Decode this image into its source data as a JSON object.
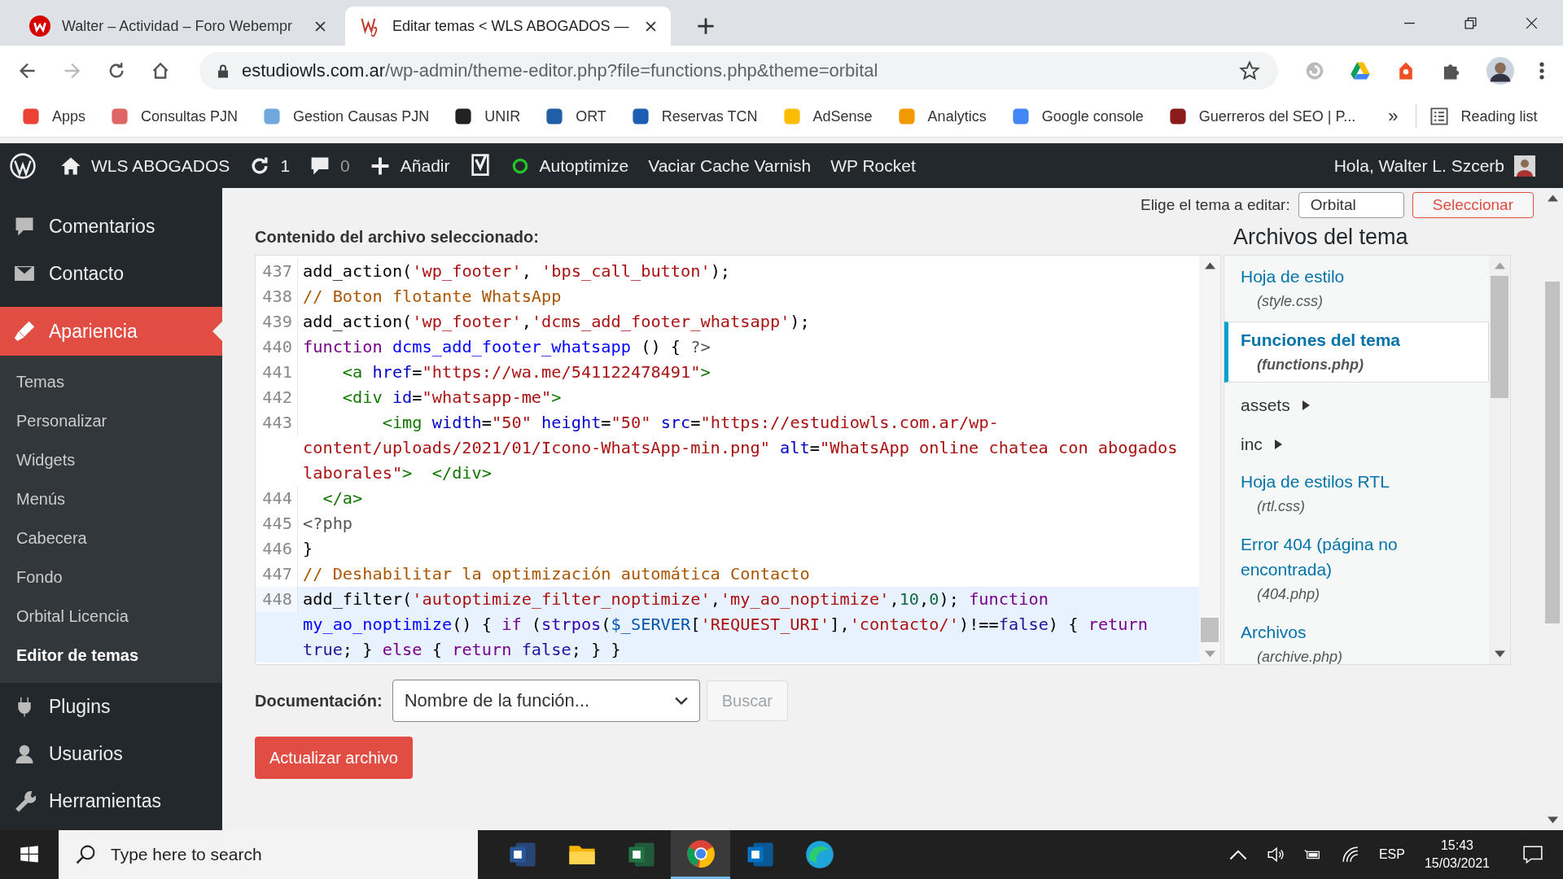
{
  "browser": {
    "tabs": [
      {
        "title": "Walter – Actividad – Foro Webempr",
        "selected": false
      },
      {
        "title": "Editar temas < WLS ABOGADOS —",
        "selected": true
      }
    ],
    "url": {
      "host": "estudiowls.com.ar",
      "path": "/wp-admin/theme-editor.php?file=functions.php&theme=orbital"
    },
    "bookmarks": [
      "Apps",
      "Consultas PJN",
      "Gestion Causas PJN",
      "UNIR",
      "ORT",
      "Reservas TCN",
      "AdSense",
      "Analytics",
      "Google console",
      "Guerreros del SEO | P..."
    ],
    "bookmarks_more": "»",
    "reading_list": "Reading list"
  },
  "admin_bar": {
    "site": "WLS ABOGADOS",
    "updates": "1",
    "comments": "0",
    "new": "Añadir",
    "items": [
      "Autoptimize",
      "Vaciar Cache Varnish",
      "WP Rocket"
    ],
    "greeting": "Hola, Walter L. Szcerb"
  },
  "sidebar": {
    "items": [
      {
        "label": "Comentarios",
        "selected": false
      },
      {
        "label": "Contacto",
        "selected": false
      },
      {
        "label": "Apariencia",
        "selected": true,
        "children": [
          {
            "label": "Temas",
            "selected": false
          },
          {
            "label": "Personalizar",
            "selected": false
          },
          {
            "label": "Widgets",
            "selected": false
          },
          {
            "label": "Menús",
            "selected": false
          },
          {
            "label": "Cabecera",
            "selected": false
          },
          {
            "label": "Fondo",
            "selected": false
          },
          {
            "label": "Orbital Licencia",
            "selected": false
          },
          {
            "label": "Editor de temas",
            "selected": true
          }
        ]
      },
      {
        "label": "Plugins",
        "selected": false
      },
      {
        "label": "Usuarios",
        "selected": false
      },
      {
        "label": "Herramientas",
        "selected": false
      }
    ]
  },
  "theme_picker": {
    "label": "Elige el tema a editar:",
    "value": "Orbital",
    "button": "Seleccionar"
  },
  "editor": {
    "label": "Contenido del archivo seleccionado:",
    "lines": [
      {
        "number": "437",
        "active": false,
        "rows": [
          {
            "segments": [
              {
                "kind": "plain",
                "text": "add_action("
              },
              {
                "kind": "string",
                "text": "'wp_footer'"
              },
              {
                "kind": "plain",
                "text": ", "
              },
              {
                "kind": "string",
                "text": "'bps_call_button'"
              },
              {
                "kind": "plain",
                "text": ");"
              }
            ]
          }
        ]
      },
      {
        "number": "438",
        "active": false,
        "rows": [
          {
            "segments": [
              {
                "kind": "comment",
                "text": "// Boton flotante WhatsApp"
              }
            ]
          }
        ]
      },
      {
        "number": "439",
        "active": false,
        "rows": [
          {
            "segments": [
              {
                "kind": "plain",
                "text": "add_action("
              },
              {
                "kind": "string",
                "text": "'wp_footer'"
              },
              {
                "kind": "plain",
                "text": ","
              },
              {
                "kind": "string",
                "text": "'dcms_add_footer_whatsapp'"
              },
              {
                "kind": "plain",
                "text": ");"
              }
            ]
          }
        ]
      },
      {
        "number": "440",
        "active": false,
        "rows": [
          {
            "segments": [
              {
                "kind": "keyword",
                "text": "function "
              },
              {
                "kind": "def",
                "text": "dcms_add_footer_whatsapp"
              },
              {
                "kind": "plain",
                "text": " () { "
              },
              {
                "kind": "meta",
                "text": "?>"
              }
            ]
          }
        ]
      },
      {
        "number": "441",
        "active": false,
        "rows": [
          {
            "segments": [
              {
                "kind": "tag",
                "text": "    <a "
              },
              {
                "kind": "attr",
                "text": "href"
              },
              {
                "kind": "plain",
                "text": "="
              },
              {
                "kind": "string",
                "text": "\"https://wa.me/541122478491\""
              },
              {
                "kind": "tag",
                "text": ">"
              }
            ]
          }
        ]
      },
      {
        "number": "442",
        "active": false,
        "rows": [
          {
            "segments": [
              {
                "kind": "tag",
                "text": "    <div "
              },
              {
                "kind": "attr",
                "text": "id"
              },
              {
                "kind": "plain",
                "text": "="
              },
              {
                "kind": "string",
                "text": "\"whatsapp-me\""
              },
              {
                "kind": "tag",
                "text": ">"
              }
            ]
          }
        ]
      },
      {
        "number": "443",
        "active": false,
        "rows": [
          {
            "segments": [
              {
                "kind": "tag",
                "text": "        <img "
              },
              {
                "kind": "attr",
                "text": "width"
              },
              {
                "kind": "plain",
                "text": "="
              },
              {
                "kind": "string",
                "text": "\"50\" "
              },
              {
                "kind": "attr",
                "text": "height"
              },
              {
                "kind": "plain",
                "text": "="
              },
              {
                "kind": "string",
                "text": "\"50\" "
              },
              {
                "kind": "attr",
                "text": "src"
              },
              {
                "kind": "plain",
                "text": "="
              },
              {
                "kind": "string",
                "text": "\"https://estudiowls.com.ar/wp-"
              }
            ]
          },
          {
            "segments": [
              {
                "kind": "string",
                "text": "content/uploads/2021/01/Icono-WhatsApp-min.png\" "
              },
              {
                "kind": "attr",
                "text": "alt"
              },
              {
                "kind": "plain",
                "text": "="
              },
              {
                "kind": "string",
                "text": "\"WhatsApp online chatea con abogados"
              }
            ]
          },
          {
            "segments": [
              {
                "kind": "string",
                "text": "laborales\""
              },
              {
                "kind": "tag",
                "text": ">  </div>"
              }
            ]
          }
        ]
      },
      {
        "number": "444",
        "active": false,
        "rows": [
          {
            "segments": [
              {
                "kind": "tag",
                "text": "  </a>"
              }
            ]
          }
        ]
      },
      {
        "number": "445",
        "active": false,
        "rows": [
          {
            "segments": [
              {
                "kind": "meta",
                "text": "<?php"
              }
            ]
          }
        ]
      },
      {
        "number": "446",
        "active": false,
        "rows": [
          {
            "segments": [
              {
                "kind": "plain",
                "text": "}"
              }
            ]
          }
        ]
      },
      {
        "number": "447",
        "active": false,
        "rows": [
          {
            "segments": [
              {
                "kind": "comment",
                "text": "// Deshabilitar la optimización automática Contacto"
              }
            ]
          }
        ]
      },
      {
        "number": "448",
        "active": true,
        "rows": [
          {
            "segments": [
              {
                "kind": "plain",
                "text": "add_filter("
              },
              {
                "kind": "string",
                "text": "'autoptimize_filter_noptimize'"
              },
              {
                "kind": "plain",
                "text": ","
              },
              {
                "kind": "string",
                "text": "'my_ao_noptimize'"
              },
              {
                "kind": "plain",
                "text": ","
              },
              {
                "kind": "number",
                "text": "10"
              },
              {
                "kind": "plain",
                "text": ","
              },
              {
                "kind": "number",
                "text": "0"
              },
              {
                "kind": "plain",
                "text": "); "
              },
              {
                "kind": "keyword",
                "text": "function"
              }
            ]
          },
          {
            "segments": [
              {
                "kind": "def",
                "text": "my_ao_noptimize"
              },
              {
                "kind": "plain",
                "text": "() { "
              },
              {
                "kind": "keyword",
                "text": "if"
              },
              {
                "kind": "plain",
                "text": " ("
              },
              {
                "kind": "builtin",
                "text": "strpos"
              },
              {
                "kind": "plain",
                "text": "("
              },
              {
                "kind": "var",
                "text": "$_SERVER"
              },
              {
                "kind": "plain",
                "text": "["
              },
              {
                "kind": "string",
                "text": "'REQUEST_URI'"
              },
              {
                "kind": "plain",
                "text": "],"
              },
              {
                "kind": "string",
                "text": "'contacto/'"
              },
              {
                "kind": "plain",
                "text": ")!=="
              },
              {
                "kind": "atom",
                "text": "false"
              },
              {
                "kind": "plain",
                "text": ") { "
              },
              {
                "kind": "keyword",
                "text": "return"
              }
            ]
          },
          {
            "segments": [
              {
                "kind": "atom",
                "text": "true"
              },
              {
                "kind": "plain",
                "text": "; } "
              },
              {
                "kind": "keyword",
                "text": "else"
              },
              {
                "kind": "plain",
                "text": " { "
              },
              {
                "kind": "keyword",
                "text": "return "
              },
              {
                "kind": "atom",
                "text": "false"
              },
              {
                "kind": "plain",
                "text": "; } }"
              }
            ]
          }
        ]
      }
    ]
  },
  "documentation": {
    "label": "Documentación:",
    "placeholder": "Nombre de la función...",
    "button": {
      "label": "Buscar",
      "disabled": true
    }
  },
  "update_button": "Actualizar archivo",
  "files": {
    "heading": "Archivos del tema",
    "items": [
      {
        "kind": "file",
        "name": "Hoja de estilo",
        "file": "(style.css)",
        "selected": false
      },
      {
        "kind": "file",
        "name": "Funciones del tema",
        "file": "(functions.php)",
        "selected": true
      },
      {
        "kind": "folder",
        "name": "assets",
        "expanded": false
      },
      {
        "kind": "folder",
        "name": "inc",
        "expanded": false
      },
      {
        "kind": "file",
        "name": "Hoja de estilos RTL",
        "file": "(rtl.css)",
        "selected": false
      },
      {
        "kind": "file",
        "name": "Error 404 (página no encontrada)",
        "file": "(404.php)",
        "selected": false
      },
      {
        "kind": "file",
        "name": "Archivos",
        "file": "(archive.php)",
        "selected": false
      }
    ]
  },
  "taskbar": {
    "search_placeholder": "Type here to search",
    "apps": [
      {
        "selected": false
      },
      {
        "selected": false
      },
      {
        "selected": false
      },
      {
        "selected": true
      },
      {
        "selected": false
      },
      {
        "selected": false
      }
    ],
    "language": "ESP",
    "time": "15:43",
    "date": "15/03/2021"
  }
}
